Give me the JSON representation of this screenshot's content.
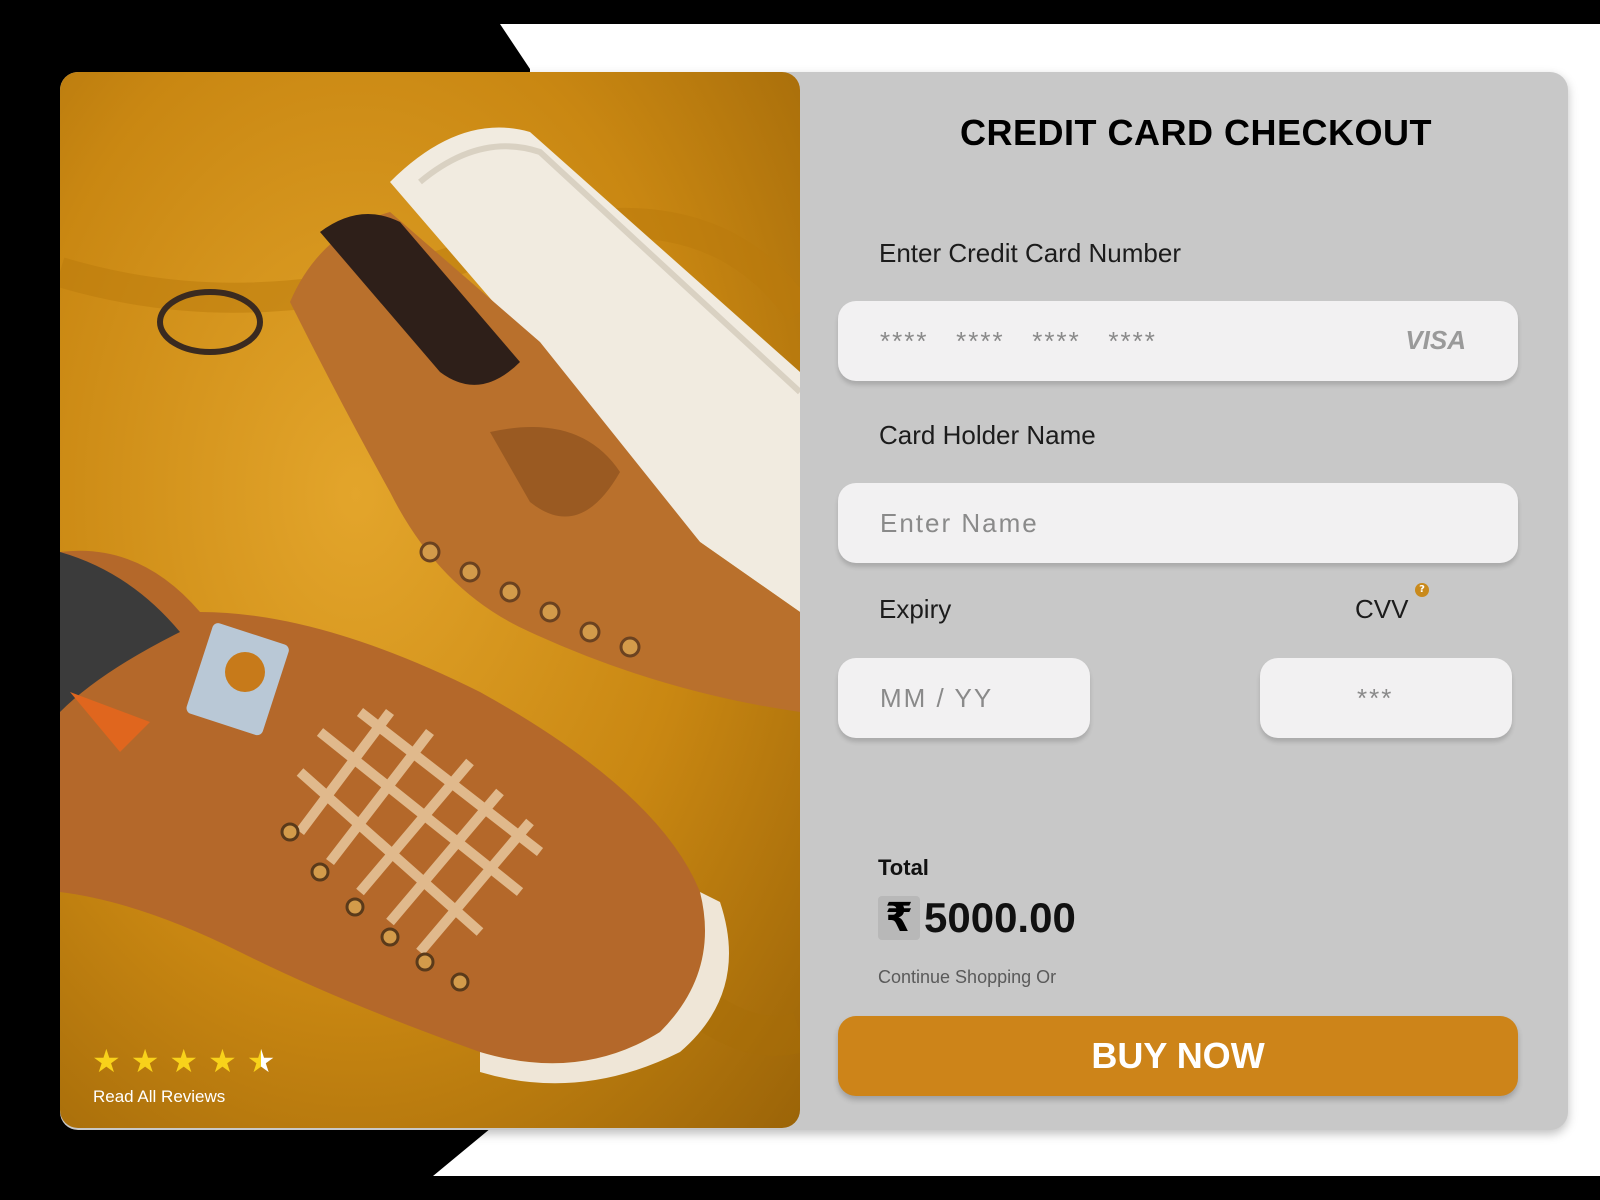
{
  "checkout": {
    "title": "CREDIT CARD CHECKOUT",
    "card_number_label": "Enter Credit Card Number",
    "card_number_placeholder": "****   ****   ****   ****",
    "card_brand": "VISA",
    "holder_label": "Card Holder Name",
    "holder_placeholder": "Enter Name",
    "expiry_label": "Expiry",
    "expiry_placeholder": "MM / YY",
    "cvv_label": "CVV",
    "cvv_help": "?",
    "cvv_placeholder": "***",
    "total_label": "Total",
    "currency_symbol": "₹",
    "total_amount": "5000.00",
    "continue_text": "Continue Shopping Or",
    "buy_label": "BUY NOW"
  },
  "product": {
    "rating": 4.5,
    "rating_max": 5,
    "reviews_link": "Read All Reviews"
  },
  "colors": {
    "accent": "#cd8419",
    "panel": "#c8c8c8",
    "field": "#f2f1f2",
    "star": "#f8d21a"
  }
}
